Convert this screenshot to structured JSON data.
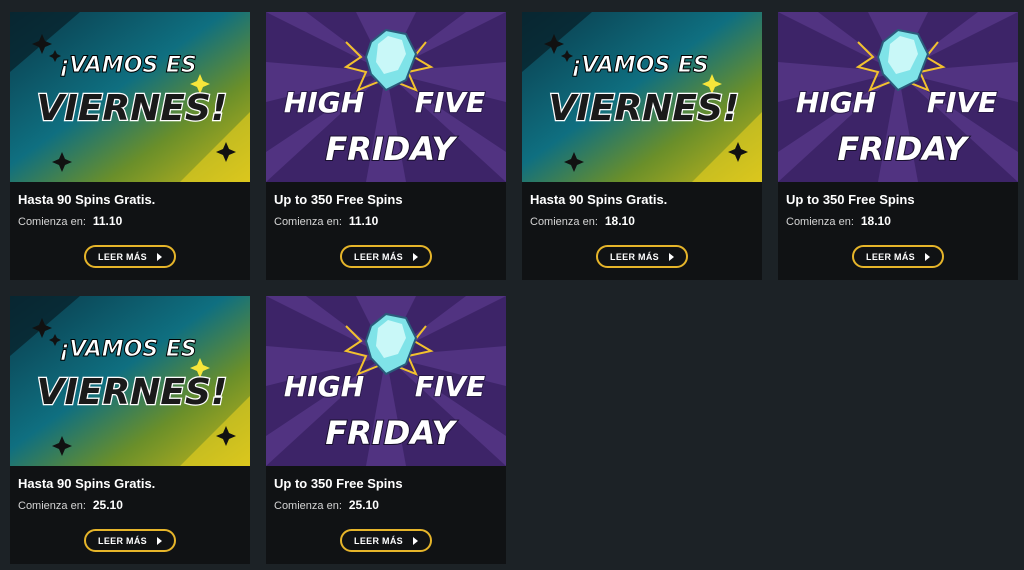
{
  "colors": {
    "page_bg": "#1c2226",
    "card_bg": "#101214",
    "accent": "#e6b52a",
    "viernes_bg_left": "#0f5c70",
    "viernes_bg_right": "#c9b81a",
    "highfive_bg": "#4a2d7a"
  },
  "banners": {
    "viernes": {
      "line1": "¡VAMOS ES",
      "line2": "VIERNES!"
    },
    "highfive": {
      "word1": "HIGH",
      "word2": "FIVE",
      "word3": "FRIDAY"
    }
  },
  "promotions": [
    {
      "banner": "viernes",
      "icon": "sparkle-icon",
      "title": "Hasta 90 Spins Gratis.",
      "date_label": "Comienza en:",
      "date": "11.10",
      "button_label": "LEER MÁS"
    },
    {
      "banner": "highfive",
      "icon": "gem-icon",
      "title": "Up to 350 Free Spins",
      "date_label": "Comienza en:",
      "date": "11.10",
      "button_label": "LEER MÁS"
    },
    {
      "banner": "viernes",
      "icon": "sparkle-icon",
      "title": "Hasta 90 Spins Gratis.",
      "date_label": "Comienza en:",
      "date": "18.10",
      "button_label": "LEER MÁS"
    },
    {
      "banner": "highfive",
      "icon": "gem-icon",
      "title": "Up to 350 Free Spins",
      "date_label": "Comienza en:",
      "date": "18.10",
      "button_label": "LEER MÁS"
    },
    {
      "banner": "viernes",
      "icon": "sparkle-icon",
      "title": "Hasta 90 Spins Gratis.",
      "date_label": "Comienza en:",
      "date": "25.10",
      "button_label": "LEER MÁS"
    },
    {
      "banner": "highfive",
      "icon": "gem-icon",
      "title": "Up to 350 Free Spins",
      "date_label": "Comienza en:",
      "date": "25.10",
      "button_label": "LEER MÁS"
    }
  ]
}
